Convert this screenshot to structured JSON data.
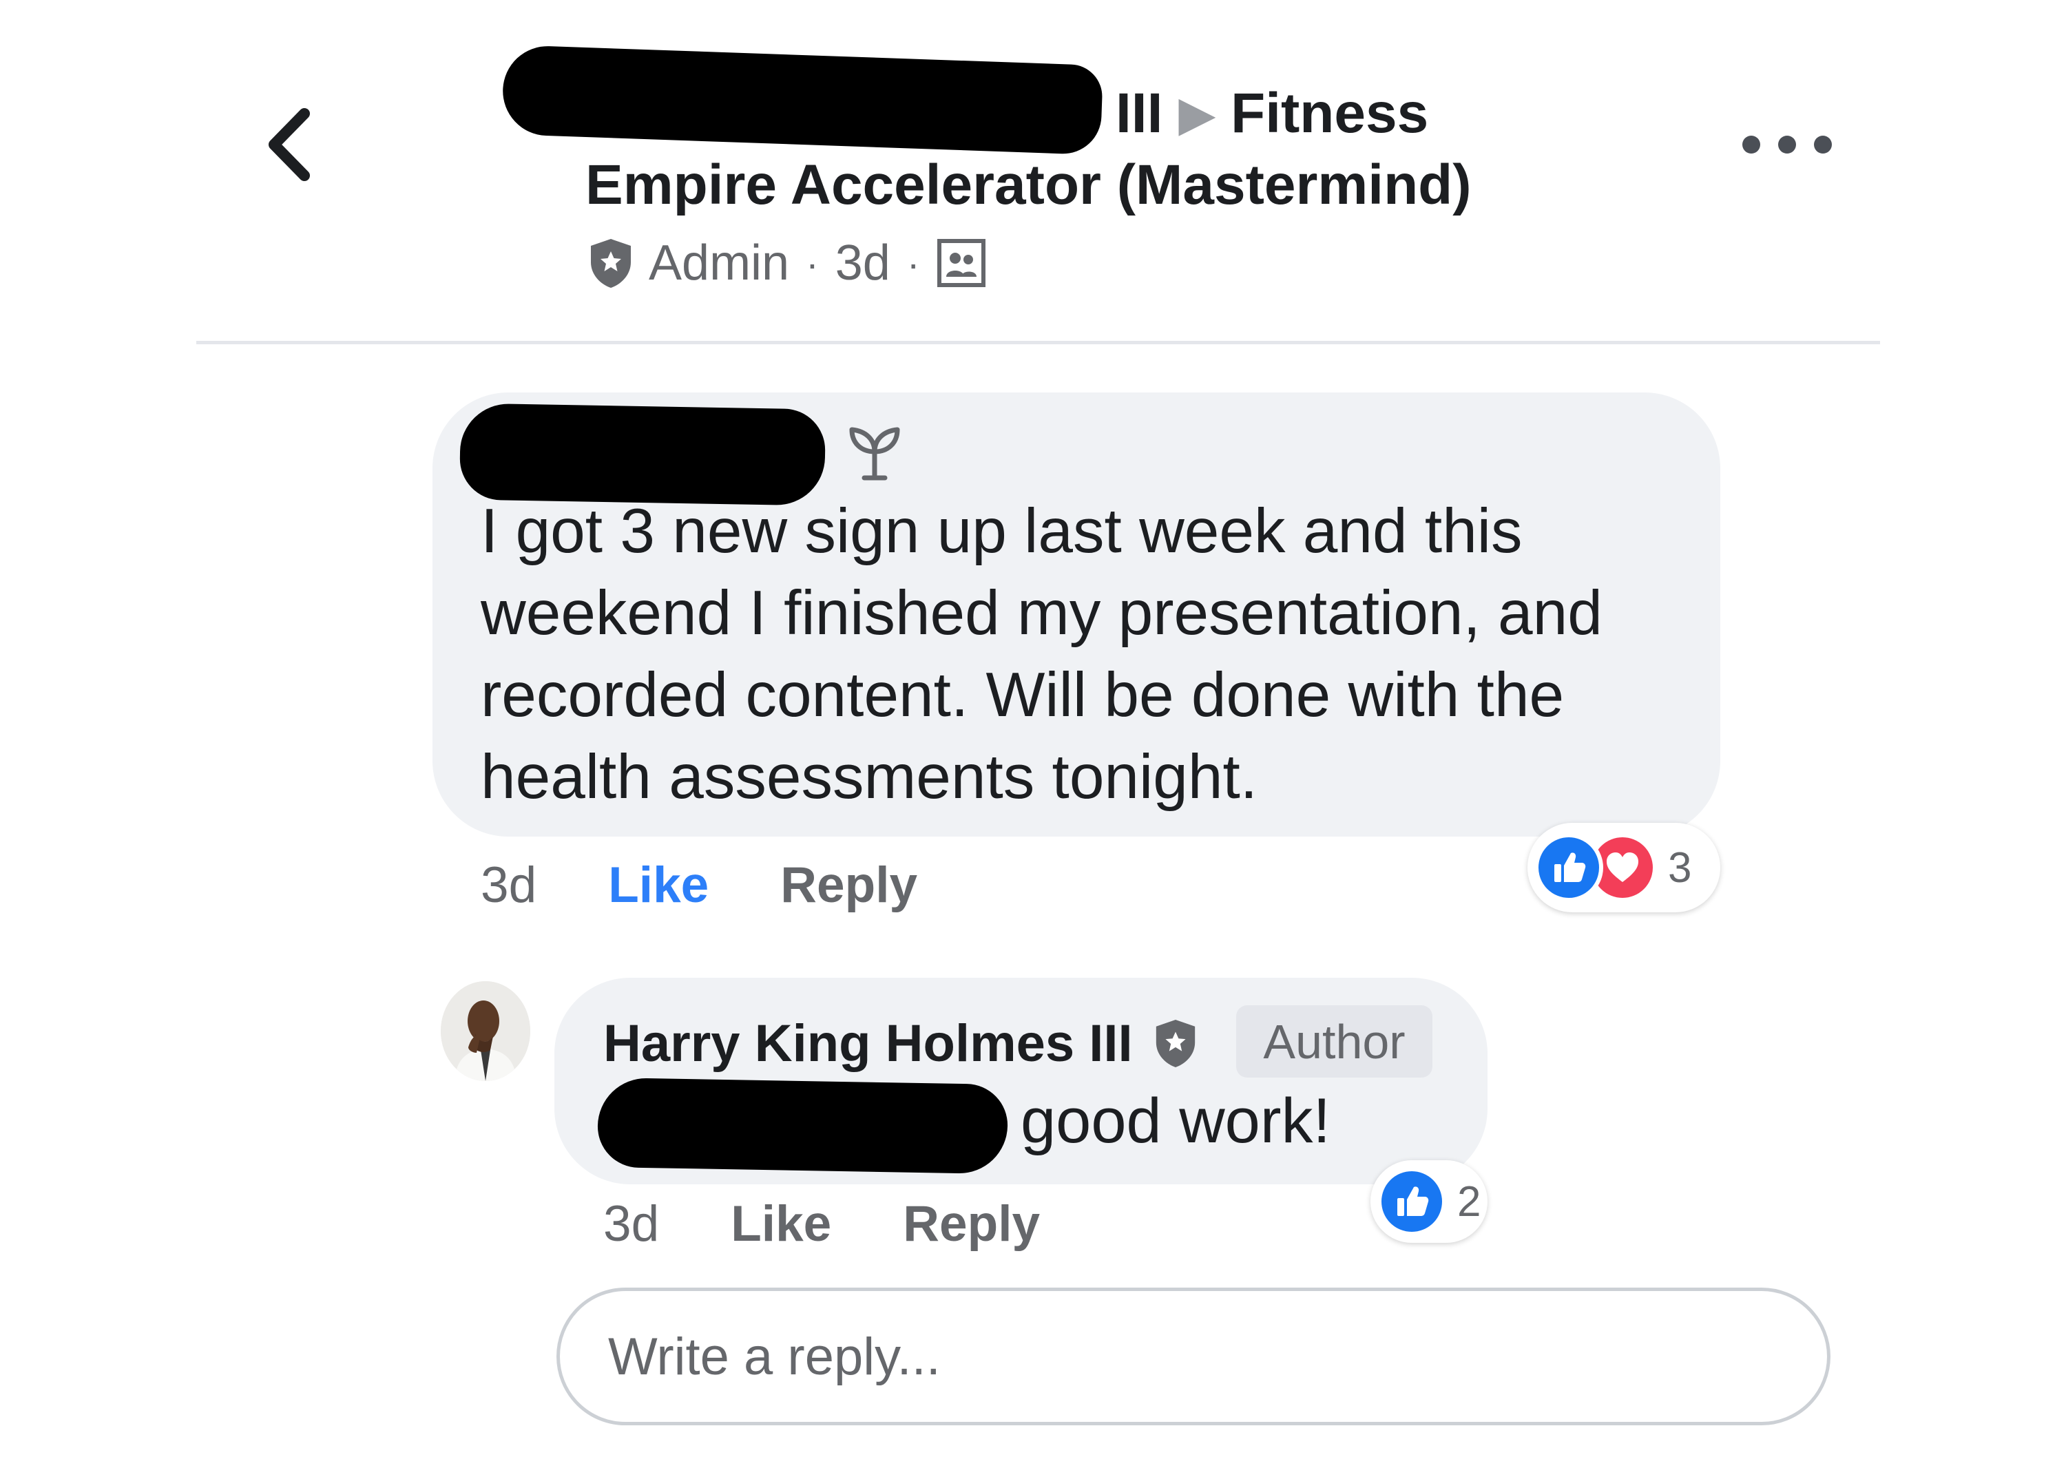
{
  "header": {
    "title_suffix_line1": "III",
    "separator": "▶",
    "group_line1": "Fitness",
    "group_line2": "Empire Accelerator (Mastermind)",
    "role": "Admin",
    "time": "3d",
    "icons": {
      "back": "chevron-left-icon",
      "more": "more-dots-icon",
      "role": "admin-shield-icon",
      "audience": "group-members-icon"
    }
  },
  "comment": {
    "text": "I got 3 new sign up last week and this weekend I finished my presentation, and recorded content. Will be done with the health assessments tonight.",
    "time": "3d",
    "like_label": "Like",
    "reply_label": "Reply",
    "reaction_count": "3",
    "name_icon": "new-member-sprout-icon"
  },
  "reply": {
    "author": "Harry King Holmes III",
    "badge": "Author",
    "text": "good work!",
    "time": "3d",
    "like_label": "Like",
    "reply_label": "Reply",
    "reaction_count": "2"
  },
  "reply_input": {
    "placeholder": "Write a reply..."
  },
  "colors": {
    "accent": "#2d7ff9",
    "like_reaction": "#1877f2",
    "love_reaction": "#f33e58",
    "bubble": "#f0f2f5",
    "muted_text": "#65676b"
  }
}
